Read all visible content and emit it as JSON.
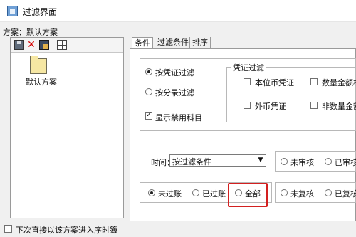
{
  "window": {
    "title": "过滤界面"
  },
  "scheme": {
    "label": "方案：默认方案",
    "item_label": "默认方案"
  },
  "toolbar": {
    "icons": [
      "save-icon",
      "delete-icon",
      "copy-icon",
      "grid-icon"
    ]
  },
  "footer": {
    "next_time_label": "下次直接以该方案进入序时簿",
    "next_time_checked": false
  },
  "tabs": [
    {
      "label": "条件",
      "active": true
    },
    {
      "label": "过滤条件",
      "active": false
    },
    {
      "label": "排序",
      "active": false
    }
  ],
  "filter_mode": {
    "options": [
      {
        "label": "按凭证过滤",
        "selected": true
      },
      {
        "label": "按分录过滤",
        "selected": false
      }
    ],
    "show_disabled_accounts": {
      "label": "显示禁用科目",
      "checked": true
    }
  },
  "voucher_filter": {
    "title": "凭证过滤",
    "options": [
      {
        "label": "本位币凭证",
        "checked": false
      },
      {
        "label": "数量金额核",
        "checked": false
      },
      {
        "label": "外币凭证",
        "checked": false
      },
      {
        "label": "非数量金额",
        "checked": false
      }
    ]
  },
  "time": {
    "label": "时间：",
    "value": "按过滤条件"
  },
  "audit": {
    "options": [
      {
        "label": "未审核",
        "selected": false
      },
      {
        "label": "已审核",
        "selected": false
      }
    ]
  },
  "posting": {
    "options": [
      {
        "label": "未过账",
        "selected": true
      },
      {
        "label": "已过账",
        "selected": false
      },
      {
        "label": "全部",
        "selected": false
      }
    ]
  },
  "review": {
    "options": [
      {
        "label": "未复核",
        "selected": false
      },
      {
        "label": "已复核",
        "selected": false
      }
    ]
  },
  "colors": {
    "highlight": "#d32020",
    "background": "#f0f0f0"
  }
}
